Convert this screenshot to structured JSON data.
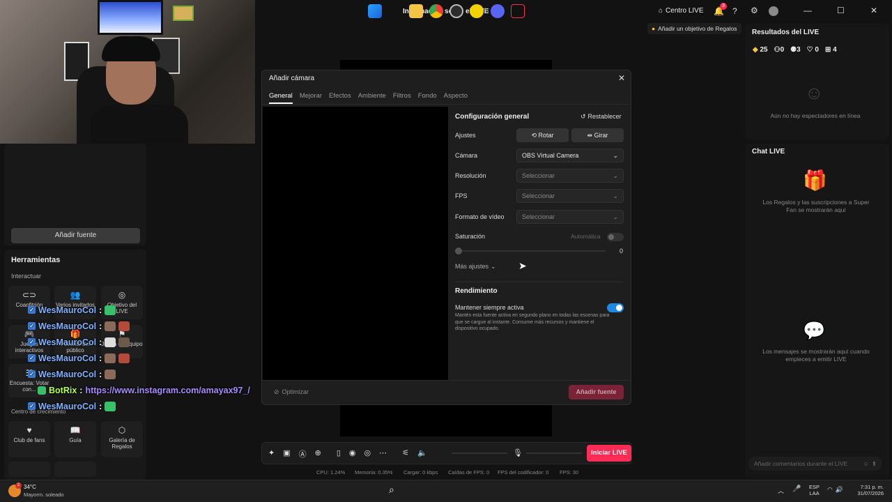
{
  "topbar": {
    "title": "Información sobre el LIVE",
    "centro": "Centro LIVE",
    "notif_count": "3",
    "goal_hint": "Añadir un objetivo de Regalos"
  },
  "left": {
    "add_source": "Añadir fuente",
    "tools_title": "Herramientas",
    "interact": "Interactuar",
    "tools": [
      {
        "label": "Coanfitrión",
        "icon": "link-icon"
      },
      {
        "label": "Varios invitados",
        "icon": "users-icon"
      },
      {
        "label": "Objetivo del LIVE",
        "icon": "target-icon"
      },
      {
        "label": "Juegos interactivos",
        "icon": "gamepad-icon"
      },
      {
        "label": "Favorito del público",
        "icon": "gift-icon"
      },
      {
        "label": "Juega en equipo",
        "icon": "team-icon"
      },
      {
        "label": "Encuesta: Votar con...",
        "icon": "poll-icon"
      }
    ],
    "growth": "Centro de crecimiento",
    "growth_tools": [
      {
        "label": "Club de fans",
        "icon": "heart-icon"
      },
      {
        "label": "Guía",
        "icon": "book-icon"
      },
      {
        "label": "Galería de Regalos",
        "icon": "gallery-icon"
      }
    ]
  },
  "chat_overlay": [
    {
      "name": "WesMauroCol",
      "sep": ":",
      "text": ""
    },
    {
      "name": "WesMauroCol",
      "sep": ":",
      "text": ""
    },
    {
      "name": "WesMauroCol",
      "sep": ":",
      "text": ""
    },
    {
      "name": "WesMauroCol",
      "sep": ":",
      "text": ""
    },
    {
      "name": "WesMauroCol",
      "sep": ":",
      "text": ""
    },
    {
      "name": "BotRix",
      "sep": ":",
      "text": "https://www.instagram.com/amayax97_/"
    },
    {
      "name": "WesMauroCol",
      "sep": ":",
      "text": ""
    }
  ],
  "dialog": {
    "title": "Añadir cámara",
    "tabs": [
      "General",
      "Mejorar",
      "Efectos",
      "Ambiente",
      "Filtros",
      "Fondo",
      "Aspecto"
    ],
    "section_general": "Configuración general",
    "reset": "Restablecer",
    "ajustes": "Ajustes",
    "rotate": "Rotar",
    "flip": "Girar",
    "camera_label": "Cámara",
    "camera_value": "OBS Virtual Camera",
    "resolution_label": "Resolución",
    "fps_label": "FPS",
    "format_label": "Formato de vídeo",
    "select_placeholder": "Seleccionar",
    "saturation_label": "Saturación",
    "auto_label": "Automática",
    "saturation_value": "0",
    "more_settings": "Más ajustes",
    "performance": "Rendimiento",
    "keep_active": "Mantener siempre activa",
    "keep_active_desc": "Mantén esta fuente activa en segundo plano en todas las escenas para que se cargue al instante. Consume más recursos y mantiene el dispositivo ocupado.",
    "optimize": "Optimizar",
    "add_source": "Añadir fuente"
  },
  "right": {
    "results_title": "Resultados del LIVE",
    "stats": [
      "25",
      "0",
      "3",
      "0",
      "4"
    ],
    "no_viewers": "Aún no hay espectadores en línea",
    "chat_title": "Chat LIVE",
    "gifts_msg": "Los Regalos y las suscripciones a Super Fan se mostrarán aquí",
    "messages_msg": "Los mensajes se mostrarán aquí cuando empieces a emitir LIVE",
    "comment_placeholder": "Añadir comentarios durante el LIVE"
  },
  "toolbar": {
    "go_live": "Iniciar LIVE"
  },
  "status": {
    "cpu": "CPU: 1.24%",
    "mem": "Memoria: 0.35%",
    "load": "Cargar: 0 kbps",
    "drops": "Caídas de FPS: 0",
    "enc": "FPS del codificador: 0",
    "fps": "FPS: 30"
  },
  "taskbar": {
    "weather_badge": "2",
    "temp": "34°C",
    "weather": "Mayorm. soleado",
    "lang1": "ESP",
    "lang2": "LAA",
    "time": "7:31 p. m.",
    "date": "31/07/2026"
  },
  "colors": {
    "accent": "#fe2c55",
    "toggle": "#1e88e5"
  }
}
